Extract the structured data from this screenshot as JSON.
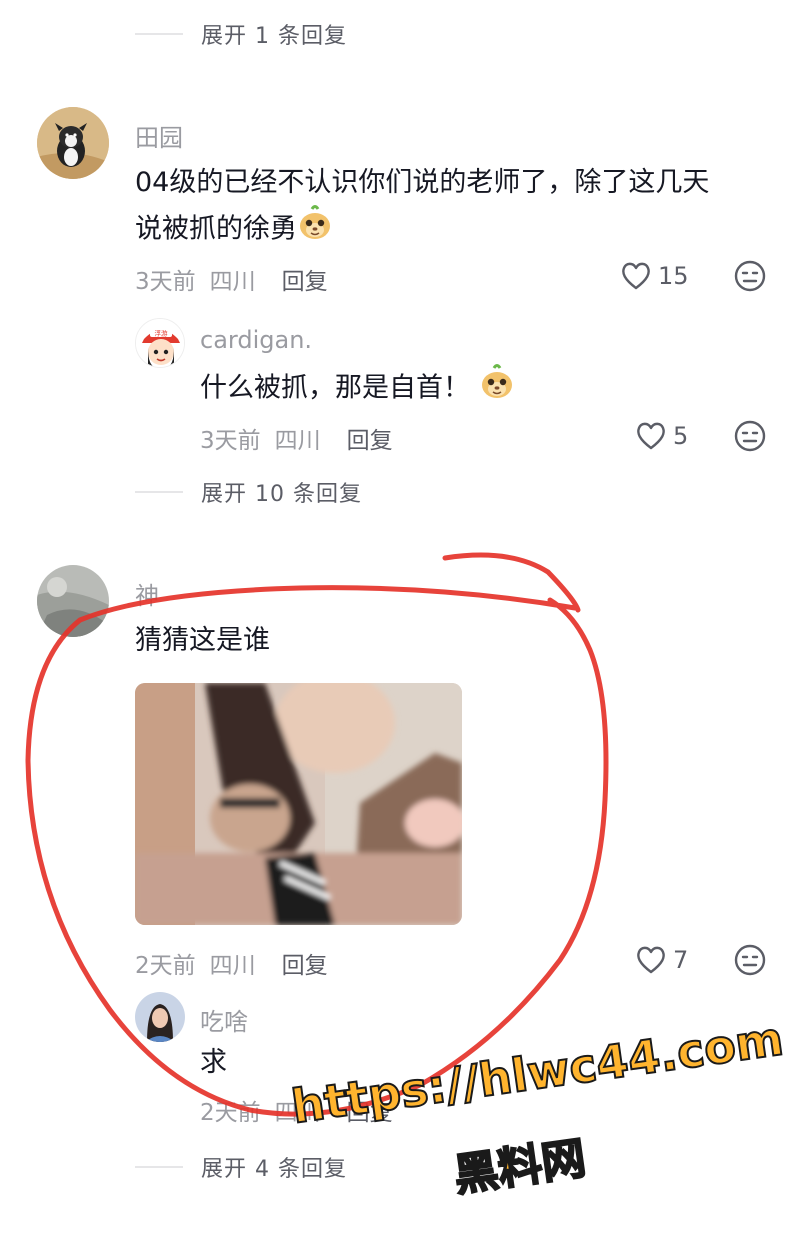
{
  "thread": {
    "expand_top": "展开 1 条回复",
    "expand_mid": "展开 10 条回复",
    "expand_bottom": "展开 4 条回复"
  },
  "comments": [
    {
      "user": "田园",
      "text_line1": "04级的已经不认识你们说的老师了，除了这几天",
      "text_line2": "说被抓的徐勇",
      "time": "3天前",
      "location": "四川",
      "reply": "回复",
      "likes": "15"
    },
    {
      "user": "cardigan.",
      "text": "什么被抓，那是自首！",
      "time": "3天前",
      "location": "四川",
      "reply": "回复",
      "likes": "5",
      "avatar_badge": "浮游"
    },
    {
      "user": "神",
      "text": "猜猜这是谁",
      "time": "2天前",
      "location": "四川",
      "reply": "回复",
      "likes": "7"
    },
    {
      "user": "吃啥",
      "text": "求",
      "time": "2天前",
      "location": "四川",
      "reply": "回复"
    }
  ],
  "watermark": {
    "url": "https://hlwc44.com",
    "name": "黑料网"
  },
  "colors": {
    "annotation_red": "#e5332a",
    "watermark_fill": "#ffb42e",
    "secondary_text": "#9a9ba1"
  }
}
